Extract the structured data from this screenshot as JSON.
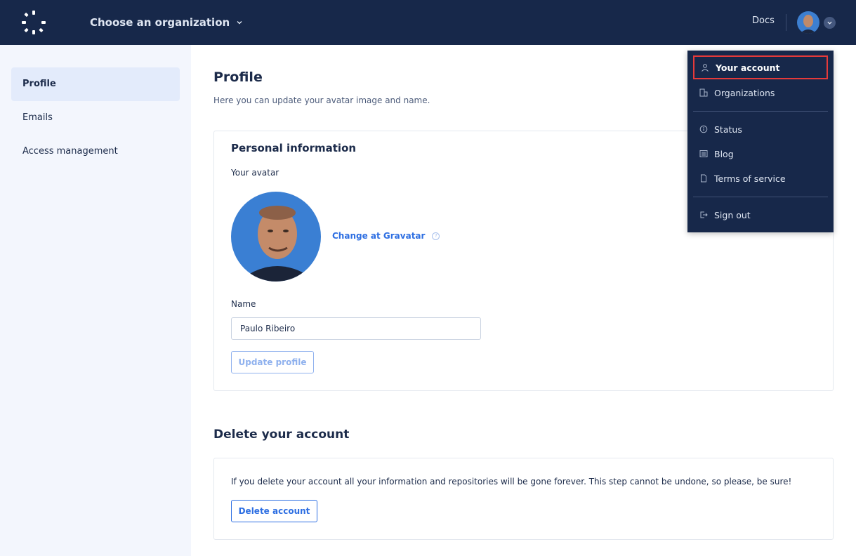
{
  "header": {
    "org_chooser_label": "Choose an organization",
    "docs_label": "Docs"
  },
  "sidebar": {
    "items": [
      {
        "label": "Profile",
        "active": true
      },
      {
        "label": "Emails"
      },
      {
        "label": "Access management"
      }
    ]
  },
  "profile": {
    "title": "Profile",
    "subtitle": "Here you can update your avatar image and name.",
    "card_title": "Personal information",
    "avatar_label": "Your avatar",
    "gravatar_link": "Change at Gravatar",
    "name_label": "Name",
    "name_value": "Paulo Ribeiro",
    "update_button": "Update profile"
  },
  "delete": {
    "title": "Delete your account",
    "text": "If you delete your account all your information and repositories will be gone forever. This step cannot be undone, so please, be sure!",
    "button": "Delete account"
  },
  "user_menu": {
    "items": [
      {
        "label": "Your account",
        "icon": "user-icon",
        "selected": true
      },
      {
        "label": "Organizations",
        "icon": "building-icon"
      },
      {
        "label": "Status",
        "icon": "info-icon"
      },
      {
        "label": "Blog",
        "icon": "newspaper-icon"
      },
      {
        "label": "Terms of service",
        "icon": "document-icon"
      },
      {
        "label": "Sign out",
        "icon": "sign-out-icon"
      }
    ]
  },
  "colors": {
    "topbar": "#17284a",
    "accent": "#2e6fe2",
    "highlight": "#e53a3a",
    "sidebar_bg": "#f3f6fd"
  }
}
